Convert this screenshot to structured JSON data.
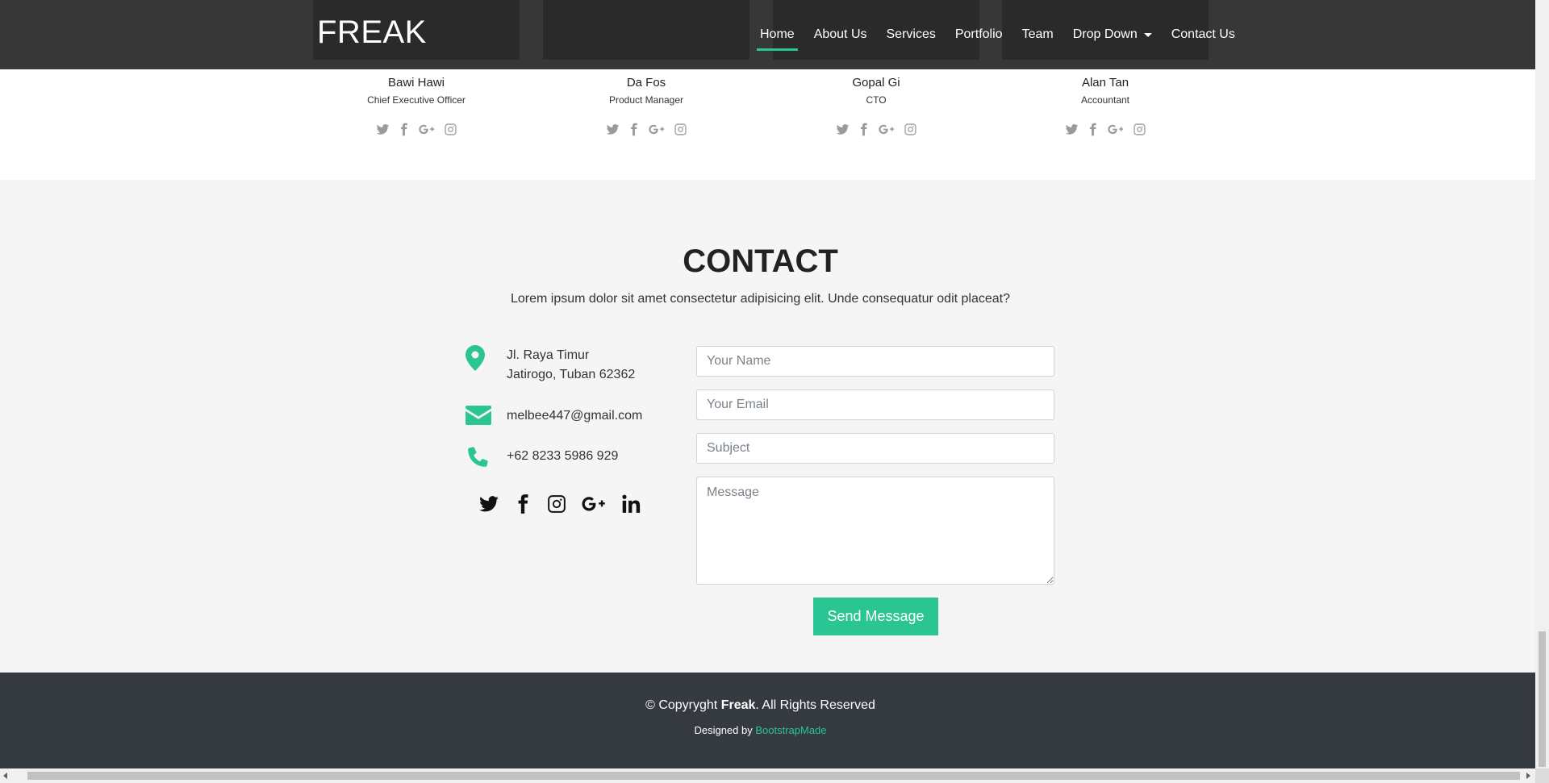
{
  "brand": "FREAK",
  "nav": {
    "items": [
      {
        "label": "Home",
        "active": true
      },
      {
        "label": "About Us"
      },
      {
        "label": "Services"
      },
      {
        "label": "Portfolio"
      },
      {
        "label": "Team"
      },
      {
        "label": "Drop Down",
        "dropdown": true
      },
      {
        "label": "Contact Us"
      }
    ]
  },
  "team": {
    "members": [
      {
        "name": "Bawi Hawi",
        "role": "Chief Executive Officer"
      },
      {
        "name": "Da Fos",
        "role": "Product Manager"
      },
      {
        "name": "Gopal Gi",
        "role": "CTO"
      },
      {
        "name": "Alan Tan",
        "role": "Accountant"
      }
    ],
    "social_icons": [
      "twitter-icon",
      "facebook-icon",
      "google-plus-icon",
      "instagram-icon"
    ]
  },
  "contact": {
    "title": "CONTACT",
    "description": "Lorem ipsum dolor sit amet consectetur adipisicing elit. Unde consequatur odit placeat?",
    "address_line1": "Jl. Raya Timur",
    "address_line2": "Jatirogo, Tuban 62362",
    "email": "melbee447@gmail.com",
    "phone": "+62 8233 5986 929",
    "social_icons": [
      "twitter-icon",
      "facebook-icon",
      "instagram-icon",
      "google-plus-icon",
      "linkedin-icon"
    ],
    "form": {
      "name_placeholder": "Your Name",
      "email_placeholder": "Your Email",
      "subject_placeholder": "Subject",
      "message_placeholder": "Message",
      "submit_label": "Send Message"
    }
  },
  "footer": {
    "copyright_prefix": "© Copyryght",
    "copyright_brand": "Freak",
    "copyright_suffix": ". All Rights Reserved",
    "designed_prefix": "Designed by",
    "designed_link": "BootstrapMade"
  },
  "colors": {
    "accent": "#2bc594",
    "navbar": "#2a2a2a",
    "footer": "#343a40"
  }
}
